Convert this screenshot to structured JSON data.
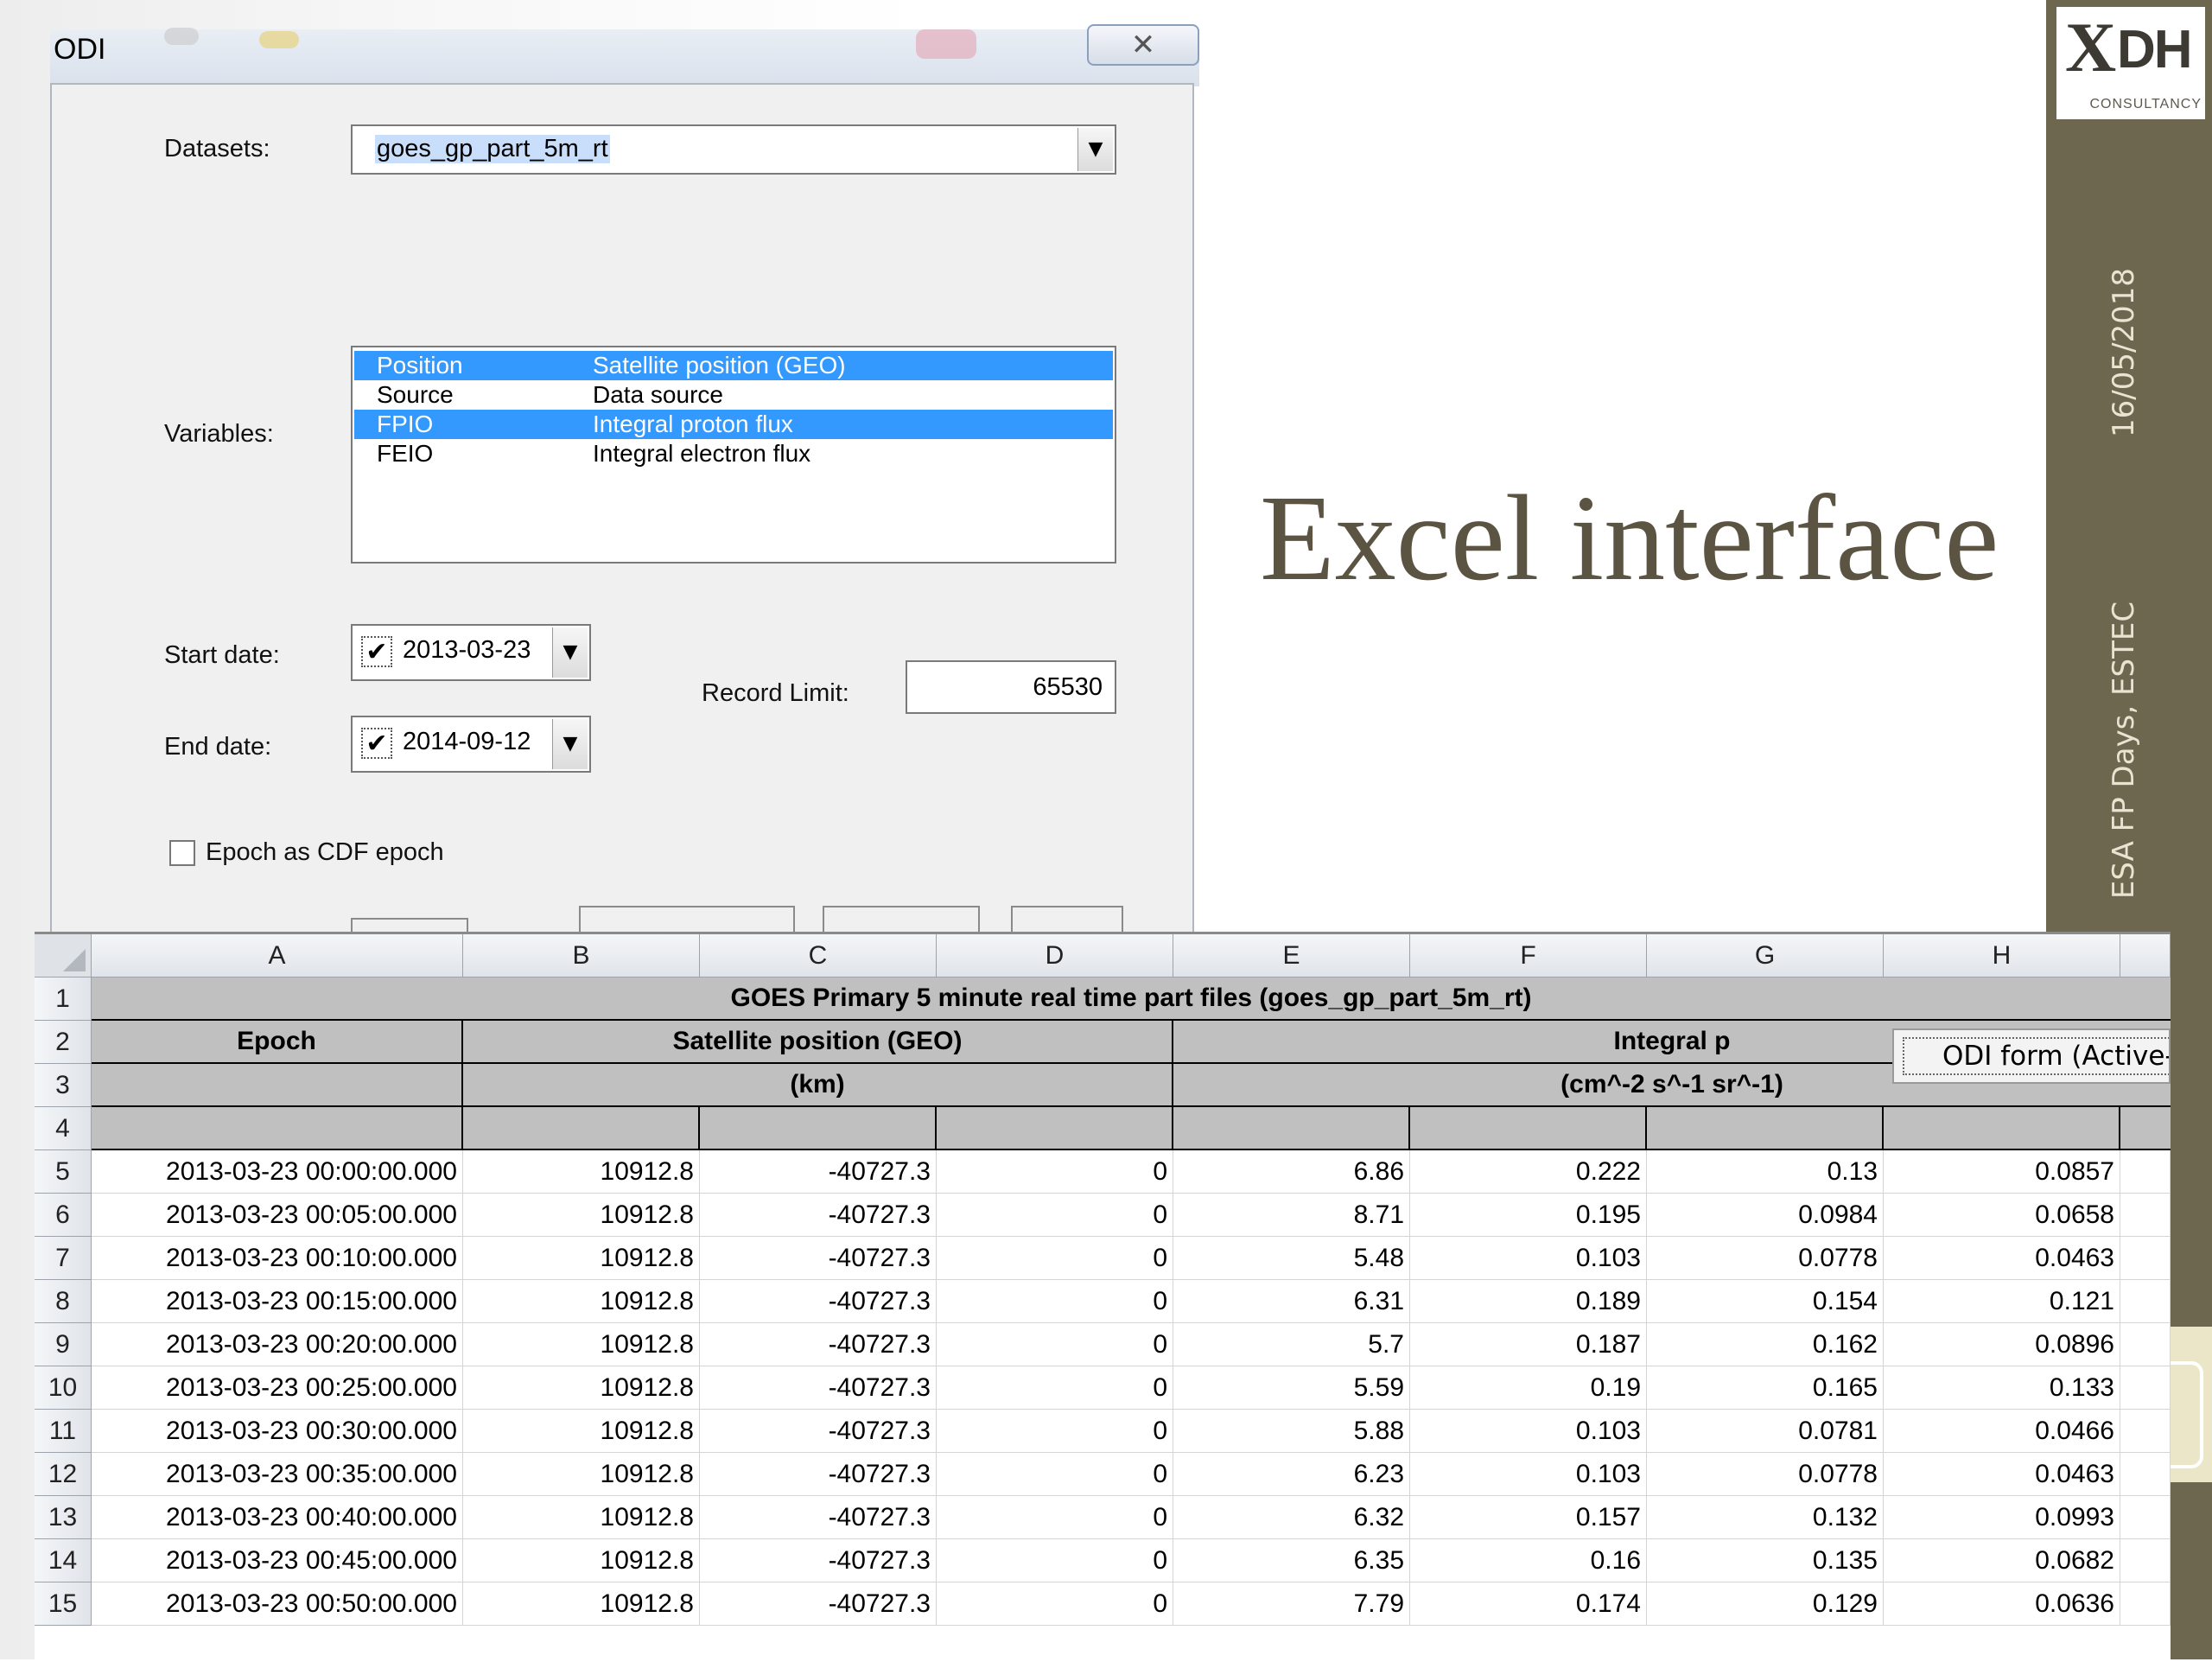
{
  "slide": {
    "title": "Excel interface",
    "date": "16/05/2018",
    "event": "ESA FP Days, ESTEC",
    "logo_mark": "X",
    "logo_text": "DH",
    "logo_sub": "CONSULTANCY",
    "sidebar_color": "#6e6750"
  },
  "dialog": {
    "title": "ODI",
    "close_glyph": "✕",
    "datasets_label": "Datasets:",
    "dataset_value": "goes_gp_part_5m_rt",
    "variables_label": "Variables:",
    "variables": [
      {
        "name": "Position",
        "desc": "Satellite position (GEO)",
        "selected": true
      },
      {
        "name": "Source",
        "desc": "Data source",
        "selected": false
      },
      {
        "name": "FPIO",
        "desc": "Integral proton flux",
        "selected": true
      },
      {
        "name": "FEIO",
        "desc": "Integral electron flux",
        "selected": false
      }
    ],
    "start_label": "Start date:",
    "start_value": "2013-03-23",
    "end_label": "End date:",
    "end_value": "2014-09-12",
    "record_limit_label": "Record Limit:",
    "record_limit_value": "65530",
    "epoch_label": "Epoch as CDF epoch",
    "check_glyph": "✔",
    "dropdown_glyph": "▼"
  },
  "sheet": {
    "columns": [
      "A",
      "B",
      "C",
      "D",
      "E",
      "F",
      "G",
      "H"
    ],
    "title": "GOES Primary 5 minute real time part files (goes_gp_part_5m_rt)",
    "epoch_header": "Epoch",
    "position_header": "Satellite position (GEO)",
    "position_unit": "(km)",
    "flux_header": "Integral p",
    "flux_unit": "(cm^-2 s^-1 sr^-1)",
    "popup": "ODI form (Active-",
    "rows": [
      {
        "n": "5",
        "epoch": "2013-03-23 00:00:00.000",
        "b": "10912.8",
        "c": "-40727.3",
        "d": "0",
        "e": "6.86",
        "f": "0.222",
        "g": "0.13",
        "h": "0.0857"
      },
      {
        "n": "6",
        "epoch": "2013-03-23 00:05:00.000",
        "b": "10912.8",
        "c": "-40727.3",
        "d": "0",
        "e": "8.71",
        "f": "0.195",
        "g": "0.0984",
        "h": "0.0658"
      },
      {
        "n": "7",
        "epoch": "2013-03-23 00:10:00.000",
        "b": "10912.8",
        "c": "-40727.3",
        "d": "0",
        "e": "5.48",
        "f": "0.103",
        "g": "0.0778",
        "h": "0.0463"
      },
      {
        "n": "8",
        "epoch": "2013-03-23 00:15:00.000",
        "b": "10912.8",
        "c": "-40727.3",
        "d": "0",
        "e": "6.31",
        "f": "0.189",
        "g": "0.154",
        "h": "0.121"
      },
      {
        "n": "9",
        "epoch": "2013-03-23 00:20:00.000",
        "b": "10912.8",
        "c": "-40727.3",
        "d": "0",
        "e": "5.7",
        "f": "0.187",
        "g": "0.162",
        "h": "0.0896"
      },
      {
        "n": "10",
        "epoch": "2013-03-23 00:25:00.000",
        "b": "10912.8",
        "c": "-40727.3",
        "d": "0",
        "e": "5.59",
        "f": "0.19",
        "g": "0.165",
        "h": "0.133"
      },
      {
        "n": "11",
        "epoch": "2013-03-23 00:30:00.000",
        "b": "10912.8",
        "c": "-40727.3",
        "d": "0",
        "e": "5.88",
        "f": "0.103",
        "g": "0.0781",
        "h": "0.0466"
      },
      {
        "n": "12",
        "epoch": "2013-03-23 00:35:00.000",
        "b": "10912.8",
        "c": "-40727.3",
        "d": "0",
        "e": "6.23",
        "f": "0.103",
        "g": "0.0778",
        "h": "0.0463"
      },
      {
        "n": "13",
        "epoch": "2013-03-23 00:40:00.000",
        "b": "10912.8",
        "c": "-40727.3",
        "d": "0",
        "e": "6.32",
        "f": "0.157",
        "g": "0.132",
        "h": "0.0993"
      },
      {
        "n": "14",
        "epoch": "2013-03-23 00:45:00.000",
        "b": "10912.8",
        "c": "-40727.3",
        "d": "0",
        "e": "6.35",
        "f": "0.16",
        "g": "0.135",
        "h": "0.0682"
      },
      {
        "n": "15",
        "epoch": "2013-03-23 00:50:00.000",
        "b": "10912.8",
        "c": "-40727.3",
        "d": "0",
        "e": "7.79",
        "f": "0.174",
        "g": "0.129",
        "h": "0.0636"
      }
    ]
  }
}
